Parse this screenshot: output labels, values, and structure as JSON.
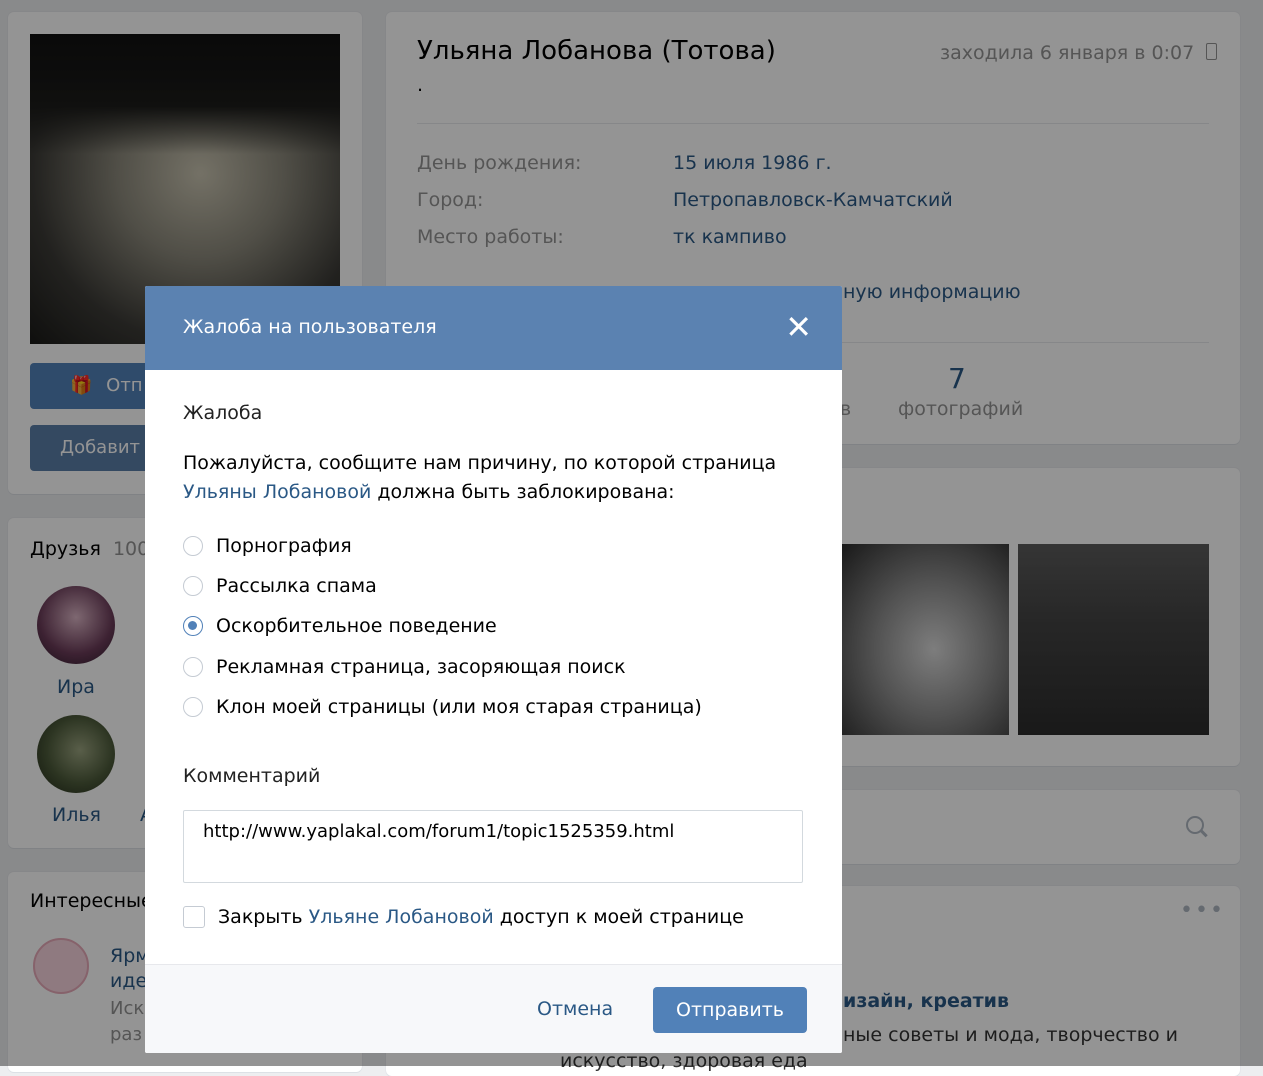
{
  "profile": {
    "name": "Ульяна Лобанова (Тотова)",
    "last_seen": "заходила 6 января в 0:07",
    "status": ".",
    "info": [
      {
        "label": "День рождения:",
        "value": "15 июля 1986 г."
      },
      {
        "label": "Город:",
        "value": "Петропавловск-Камчатский"
      },
      {
        "label": "Место работы:",
        "value": "тк кампиво"
      }
    ],
    "more_info_fragment": "ную информацию",
    "counter_value": "7",
    "counter_label": "фотографий",
    "counter_partial": "в",
    "btn_gift_fragment": "Отп",
    "btn_add_fragment": "Добавит"
  },
  "friends": {
    "title": "Друзья",
    "count_fragment": "100",
    "items": [
      {
        "name": "Ира"
      },
      {
        "name": "Илья"
      }
    ],
    "partial_letter": "А"
  },
  "interesting": {
    "title_fragment": "Интересные",
    "item_line1": "Ярм",
    "item_line2": "иде",
    "item_line3": "Иск",
    "item_line4": "раз"
  },
  "feed": {
    "headline_fragment": "изайн, креатив",
    "desc_line1": "ные советы и мода, творчество и",
    "desc_line2": "искусство, здоровая еда"
  },
  "modal": {
    "title": "Жалоба на пользователя",
    "section_label": "Жалоба",
    "prompt_before": "Пожалуйста, сообщите нам причину, по которой страница",
    "prompt_link": "Ульяны Лобановой",
    "prompt_after": " должна быть заблокирована:",
    "options": [
      {
        "label": "Порнография",
        "selected": false
      },
      {
        "label": "Рассылка спама",
        "selected": false
      },
      {
        "label": "Оскорбительное поведение",
        "selected": true
      },
      {
        "label": "Рекламная страница, засоряющая поиск",
        "selected": false
      },
      {
        "label": "Клон моей страницы (или моя старая страница)",
        "selected": false
      }
    ],
    "comment_label": "Комментарий",
    "comment_value": "http://www.yaplakal.com/forum1/topic1525359.html",
    "block_before": "Закрыть ",
    "block_link": "Ульяне Лобановой",
    "block_after": " доступ к моей странице",
    "cancel_label": "Отмена",
    "send_label": "Отправить"
  }
}
